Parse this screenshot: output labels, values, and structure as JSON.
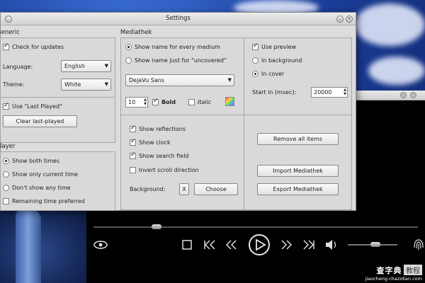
{
  "dialog": {
    "title": "Settings"
  },
  "generic": {
    "label": "Generic",
    "check_updates": {
      "label": "Check for updates",
      "checked": true
    },
    "language": {
      "label": "Language:",
      "value": "English"
    },
    "theme": {
      "label": "Theme:",
      "value": "White"
    },
    "use_last_played": {
      "label": "Use \"Last Played\"",
      "checked": true
    },
    "clear_button": "Clear last-played"
  },
  "player": {
    "label": "Player",
    "options": [
      {
        "label": "Show both times",
        "checked": true
      },
      {
        "label": "Show only current time",
        "checked": false
      },
      {
        "label": "Don't show any time",
        "checked": false
      }
    ],
    "remaining_time": {
      "label": "Remaining time preferred",
      "checked": false
    }
  },
  "mediathek": {
    "label": "Mediathek",
    "name_every": {
      "label": "Show name for every medium",
      "checked": true
    },
    "name_uncovered": {
      "label": "Show name just for \"uncovered\"",
      "checked": false
    },
    "font": "DejaVu Sans",
    "font_size": "10",
    "bold": {
      "label": "Bold",
      "checked": true
    },
    "italic": {
      "label": "Italic",
      "checked": false
    },
    "show_reflections": {
      "label": "Show reflections",
      "checked": true
    },
    "show_clock": {
      "label": "Show clock",
      "checked": true
    },
    "show_search": {
      "label": "Show search field",
      "checked": true
    },
    "invert_scroll": {
      "label": "Invert scroll direction",
      "checked": false
    },
    "background": {
      "label": "Background:",
      "clear": "X",
      "choose": "Choose"
    },
    "use_preview": {
      "label": "Use preview",
      "checked": true
    },
    "in_background": {
      "label": "In background",
      "checked": false
    },
    "in_cover": {
      "label": "In cover",
      "checked": true
    },
    "start_in": {
      "label": "Start in (msec):",
      "value": "20000"
    },
    "remove_button": "Remove all items",
    "import_button": "Import Mediathek",
    "export_button": "Export Mediathek"
  },
  "watermark": {
    "brand": "查字典",
    "tag": "教程",
    "url": "jiaocheng.chazidian.com"
  },
  "icons": [
    "eye-icon",
    "stop-icon",
    "skip-back-icon",
    "rewind-icon",
    "play-icon",
    "fast-forward-icon",
    "skip-forward-icon",
    "volume-icon",
    "fingerprint-icon"
  ]
}
